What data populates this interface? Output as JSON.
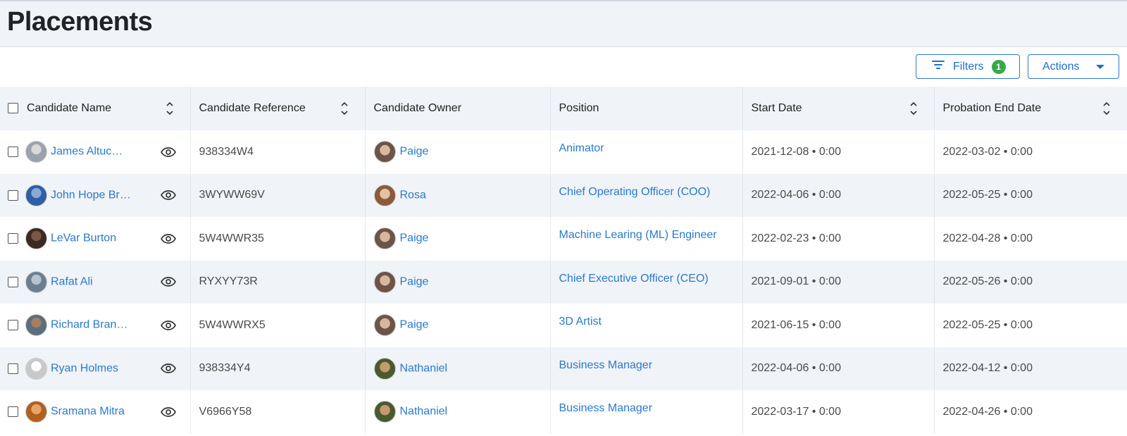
{
  "page": {
    "title": "Placements"
  },
  "toolbar": {
    "filters_label": "Filters",
    "filters_count": "1",
    "actions_label": "Actions"
  },
  "table": {
    "headers": [
      "Candidate Name",
      "Candidate Reference",
      "Candidate Owner",
      "Position",
      "Start Date",
      "Probation End Date"
    ],
    "rows": [
      {
        "name": "James Altuc…",
        "reference": "938334W4",
        "owner": "Paige",
        "position": "Animator",
        "start": "2021-12-08 • 0:00",
        "probation_end": "2022-03-02 • 0:00"
      },
      {
        "name": "John Hope Br…",
        "reference": "3WYWW69V",
        "owner": "Rosa",
        "position": "Chief Operating Officer (COO)",
        "start": "2022-04-06 • 0:00",
        "probation_end": "2022-05-25 • 0:00"
      },
      {
        "name": "LeVar Burton",
        "reference": "5W4WWR35",
        "owner": "Paige",
        "position": "Machine Learing (ML) Engineer",
        "start": "2022-02-23 • 0:00",
        "probation_end": "2022-04-28 • 0:00"
      },
      {
        "name": "Rafat Ali",
        "reference": "RYXYY73R",
        "owner": "Paige",
        "position": "Chief Executive Officer (CEO)",
        "start": "2021-09-01 • 0:00",
        "probation_end": "2022-05-26 • 0:00"
      },
      {
        "name": "Richard Bran…",
        "reference": "5W4WWRX5",
        "owner": "Paige",
        "position": "3D Artist",
        "start": "2021-06-15 • 0:00",
        "probation_end": "2022-05-25 • 0:00"
      },
      {
        "name": "Ryan Holmes",
        "reference": "938334Y4",
        "owner": "Nathaniel",
        "position": "Business Manager",
        "start": "2022-04-06 • 0:00",
        "probation_end": "2022-04-12 • 0:00"
      },
      {
        "name": "Sramana Mitra",
        "reference": "V6966Y58",
        "owner": "Nathaniel",
        "position": "Business Manager",
        "start": "2022-03-17 • 0:00",
        "probation_end": "2022-04-26 • 0:00"
      }
    ]
  },
  "icons": {
    "filter": "filter-icon",
    "sort": "sort-icon",
    "view": "eye-icon",
    "dropdown": "caret-down-icon"
  },
  "colors": {
    "accent": "#2a7acb",
    "badge": "#38a84a",
    "header_bg": "#f0f3f7"
  }
}
